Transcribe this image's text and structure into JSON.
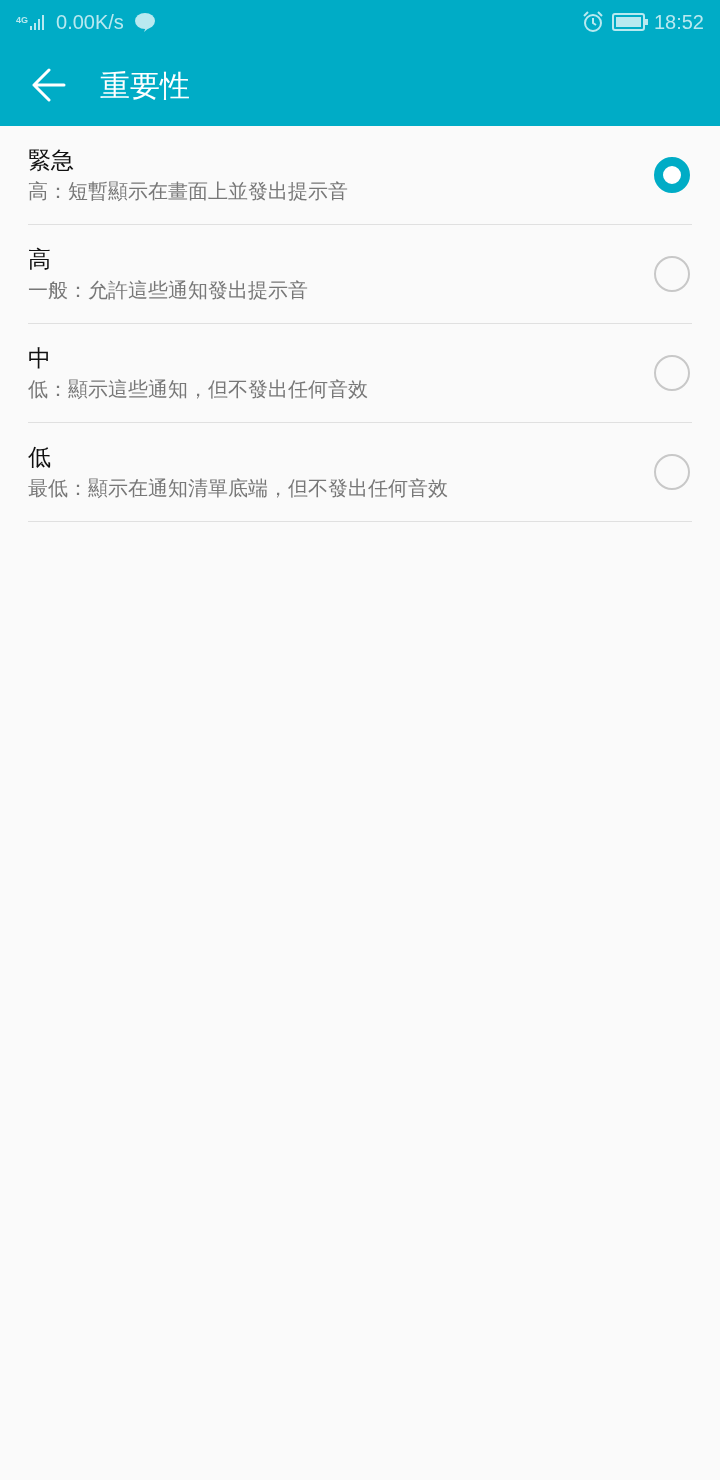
{
  "status_bar": {
    "network": "4G",
    "speed": "0.00K/s",
    "time": "18:52"
  },
  "app_bar": {
    "title": "重要性"
  },
  "options": [
    {
      "title": "緊急",
      "description": "高：短暫顯示在畫面上並發出提示音",
      "selected": true
    },
    {
      "title": "高",
      "description": "一般：允許這些通知發出提示音",
      "selected": false
    },
    {
      "title": "中",
      "description": "低：顯示這些通知，但不發出任何音效",
      "selected": false
    },
    {
      "title": "低",
      "description": "最低：顯示在通知清單底端，但不發出任何音效",
      "selected": false
    }
  ]
}
